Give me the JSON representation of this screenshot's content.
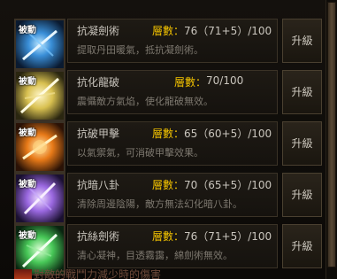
{
  "passive_tag": "被動",
  "level_label": "層數：",
  "upgrade_label": "升級",
  "skills": [
    {
      "name": "抗凝劍術",
      "level": "76（71+5）/100",
      "desc": "提取丹田暖氣，抵抗凝劍術。",
      "icon": "ice-sword-skill-icon",
      "color": "#3a8fd8"
    },
    {
      "name": "抗化龍破",
      "level": "70/100",
      "desc": "震懾敵方氣焰，使化龍破無效。",
      "icon": "dragon-break-skill-icon",
      "color": "#d8c050"
    },
    {
      "name": "抗破甲擊",
      "level": "65（60+5）/100",
      "desc": "以氣禦氣，可消破甲擊效果。",
      "icon": "armor-break-skill-icon",
      "color": "#e87a18"
    },
    {
      "name": "抗暗八卦",
      "level": "70（65+5）/100",
      "desc": "清除周邊陰陽，敵方無法幻化暗八卦。",
      "icon": "dark-bagua-skill-icon",
      "color": "#9a68e0"
    },
    {
      "name": "抗絲劍術",
      "level": "76（71+5）/100",
      "desc": "清心凝神，目透霧靄，綿劍術無效。",
      "icon": "silk-sword-skill-icon",
      "color": "#48c858"
    }
  ],
  "bottom_partial_text": "對敵的戰鬥力減少時的傷害"
}
